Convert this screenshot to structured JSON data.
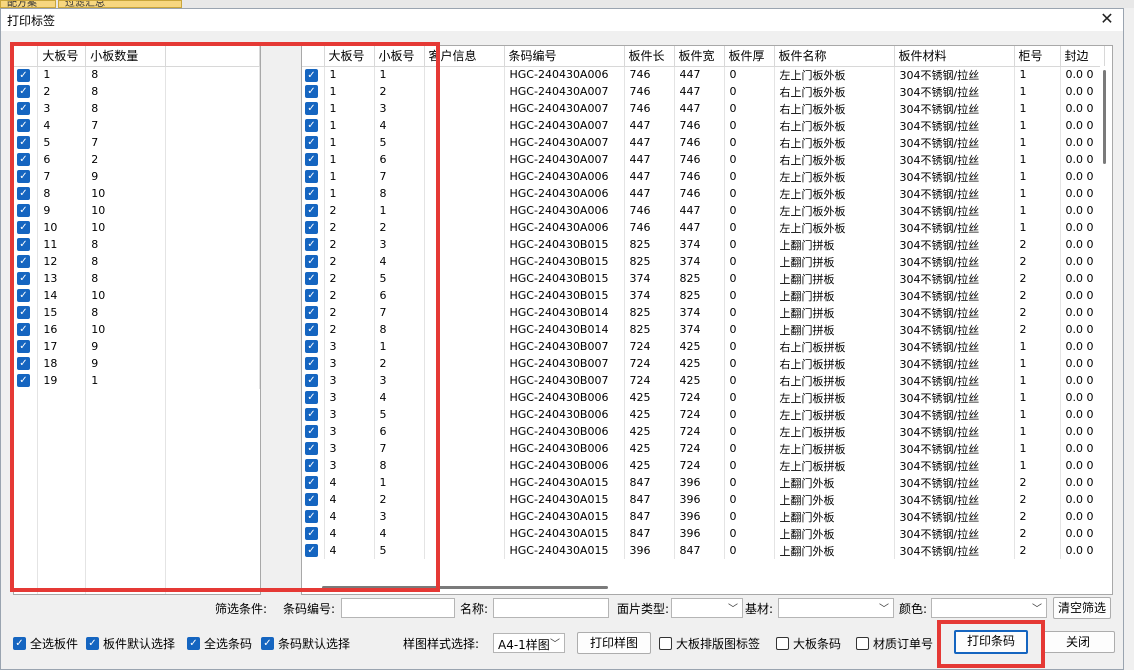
{
  "background": {
    "tab1": "配方案",
    "tab2": "过滤汇总"
  },
  "dialog": {
    "title": "打印标签",
    "close_icon": "close-icon"
  },
  "left_table": {
    "headers": [
      "大板号",
      "小板数量"
    ],
    "rows": [
      [
        "1",
        "8"
      ],
      [
        "2",
        "8"
      ],
      [
        "3",
        "8"
      ],
      [
        "4",
        "7"
      ],
      [
        "5",
        "7"
      ],
      [
        "6",
        "2"
      ],
      [
        "7",
        "9"
      ],
      [
        "8",
        "10"
      ],
      [
        "9",
        "10"
      ],
      [
        "10",
        "10"
      ],
      [
        "11",
        "8"
      ],
      [
        "12",
        "8"
      ],
      [
        "13",
        "8"
      ],
      [
        "14",
        "10"
      ],
      [
        "15",
        "8"
      ],
      [
        "16",
        "10"
      ],
      [
        "17",
        "9"
      ],
      [
        "18",
        "9"
      ],
      [
        "19",
        "1"
      ]
    ]
  },
  "right_table": {
    "headers": [
      "大板号",
      "小板号",
      "客户信息",
      "条码编号",
      "板件长",
      "板件宽",
      "板件厚",
      "板件名称",
      "板件材料",
      "柜号",
      "封边"
    ],
    "rows": [
      [
        "1",
        "1",
        "",
        "HGC-240430A006",
        "746",
        "447",
        "0",
        "左上门板外板",
        "304不锈钢/拉丝",
        "1",
        "0.0 0"
      ],
      [
        "1",
        "2",
        "",
        "HGC-240430A007",
        "746",
        "447",
        "0",
        "右上门板外板",
        "304不锈钢/拉丝",
        "1",
        "0.0 0"
      ],
      [
        "1",
        "3",
        "",
        "HGC-240430A007",
        "746",
        "447",
        "0",
        "右上门板外板",
        "304不锈钢/拉丝",
        "1",
        "0.0 0"
      ],
      [
        "1",
        "4",
        "",
        "HGC-240430A007",
        "447",
        "746",
        "0",
        "右上门板外板",
        "304不锈钢/拉丝",
        "1",
        "0.0 0"
      ],
      [
        "1",
        "5",
        "",
        "HGC-240430A007",
        "447",
        "746",
        "0",
        "右上门板外板",
        "304不锈钢/拉丝",
        "1",
        "0.0 0"
      ],
      [
        "1",
        "6",
        "",
        "HGC-240430A007",
        "447",
        "746",
        "0",
        "右上门板外板",
        "304不锈钢/拉丝",
        "1",
        "0.0 0"
      ],
      [
        "1",
        "7",
        "",
        "HGC-240430A006",
        "447",
        "746",
        "0",
        "左上门板外板",
        "304不锈钢/拉丝",
        "1",
        "0.0 0"
      ],
      [
        "1",
        "8",
        "",
        "HGC-240430A006",
        "447",
        "746",
        "0",
        "左上门板外板",
        "304不锈钢/拉丝",
        "1",
        "0.0 0"
      ],
      [
        "2",
        "1",
        "",
        "HGC-240430A006",
        "746",
        "447",
        "0",
        "左上门板外板",
        "304不锈钢/拉丝",
        "1",
        "0.0 0"
      ],
      [
        "2",
        "2",
        "",
        "HGC-240430A006",
        "746",
        "447",
        "0",
        "左上门板外板",
        "304不锈钢/拉丝",
        "1",
        "0.0 0"
      ],
      [
        "2",
        "3",
        "",
        "HGC-240430B015",
        "825",
        "374",
        "0",
        "上翻门拼板",
        "304不锈钢/拉丝",
        "2",
        "0.0 0"
      ],
      [
        "2",
        "4",
        "",
        "HGC-240430B015",
        "825",
        "374",
        "0",
        "上翻门拼板",
        "304不锈钢/拉丝",
        "2",
        "0.0 0"
      ],
      [
        "2",
        "5",
        "",
        "HGC-240430B015",
        "374",
        "825",
        "0",
        "上翻门拼板",
        "304不锈钢/拉丝",
        "2",
        "0.0 0"
      ],
      [
        "2",
        "6",
        "",
        "HGC-240430B015",
        "374",
        "825",
        "0",
        "上翻门拼板",
        "304不锈钢/拉丝",
        "2",
        "0.0 0"
      ],
      [
        "2",
        "7",
        "",
        "HGC-240430B014",
        "825",
        "374",
        "0",
        "上翻门拼板",
        "304不锈钢/拉丝",
        "2",
        "0.0 0"
      ],
      [
        "2",
        "8",
        "",
        "HGC-240430B014",
        "825",
        "374",
        "0",
        "上翻门拼板",
        "304不锈钢/拉丝",
        "2",
        "0.0 0"
      ],
      [
        "3",
        "1",
        "",
        "HGC-240430B007",
        "724",
        "425",
        "0",
        "右上门板拼板",
        "304不锈钢/拉丝",
        "1",
        "0.0 0"
      ],
      [
        "3",
        "2",
        "",
        "HGC-240430B007",
        "724",
        "425",
        "0",
        "右上门板拼板",
        "304不锈钢/拉丝",
        "1",
        "0.0 0"
      ],
      [
        "3",
        "3",
        "",
        "HGC-240430B007",
        "724",
        "425",
        "0",
        "右上门板拼板",
        "304不锈钢/拉丝",
        "1",
        "0.0 0"
      ],
      [
        "3",
        "4",
        "",
        "HGC-240430B006",
        "425",
        "724",
        "0",
        "左上门板拼板",
        "304不锈钢/拉丝",
        "1",
        "0.0 0"
      ],
      [
        "3",
        "5",
        "",
        "HGC-240430B006",
        "425",
        "724",
        "0",
        "左上门板拼板",
        "304不锈钢/拉丝",
        "1",
        "0.0 0"
      ],
      [
        "3",
        "6",
        "",
        "HGC-240430B006",
        "425",
        "724",
        "0",
        "左上门板拼板",
        "304不锈钢/拉丝",
        "1",
        "0.0 0"
      ],
      [
        "3",
        "7",
        "",
        "HGC-240430B006",
        "425",
        "724",
        "0",
        "左上门板拼板",
        "304不锈钢/拉丝",
        "1",
        "0.0 0"
      ],
      [
        "3",
        "8",
        "",
        "HGC-240430B006",
        "425",
        "724",
        "0",
        "左上门板拼板",
        "304不锈钢/拉丝",
        "1",
        "0.0 0"
      ],
      [
        "4",
        "1",
        "",
        "HGC-240430A015",
        "847",
        "396",
        "0",
        "上翻门外板",
        "304不锈钢/拉丝",
        "2",
        "0.0 0"
      ],
      [
        "4",
        "2",
        "",
        "HGC-240430A015",
        "847",
        "396",
        "0",
        "上翻门外板",
        "304不锈钢/拉丝",
        "2",
        "0.0 0"
      ],
      [
        "4",
        "3",
        "",
        "HGC-240430A015",
        "847",
        "396",
        "0",
        "上翻门外板",
        "304不锈钢/拉丝",
        "2",
        "0.0 0"
      ],
      [
        "4",
        "4",
        "",
        "HGC-240430A015",
        "847",
        "396",
        "0",
        "上翻门外板",
        "304不锈钢/拉丝",
        "2",
        "0.0 0"
      ],
      [
        "4",
        "5",
        "",
        "HGC-240430A015",
        "396",
        "847",
        "0",
        "上翻门外板",
        "304不锈钢/拉丝",
        "2",
        "0.0 0"
      ]
    ]
  },
  "filter": {
    "label": "筛选条件:",
    "barcode_label": "条码编号:",
    "name_label": "名称:",
    "face_type_label": "面片类型:",
    "base_label": "基材:",
    "color_label": "颜色:",
    "clear_button": "清空筛选"
  },
  "bottom": {
    "select_all_panels": "全选板件",
    "panels_default": "板件默认选择",
    "select_all_barcodes": "全选条码",
    "barcodes_default": "条码默认选择",
    "style_label": "样图样式选择:",
    "style_value": "A4-1样图",
    "print_sample": "打印样图",
    "big_board_label": "大板排版图标签",
    "big_board_barcode": "大板条码",
    "material_order": "材质订单号",
    "print_barcode": "打印条码",
    "close": "关闭"
  },
  "colors": {
    "accent": "#1565c0",
    "highlight": "#e53935"
  }
}
